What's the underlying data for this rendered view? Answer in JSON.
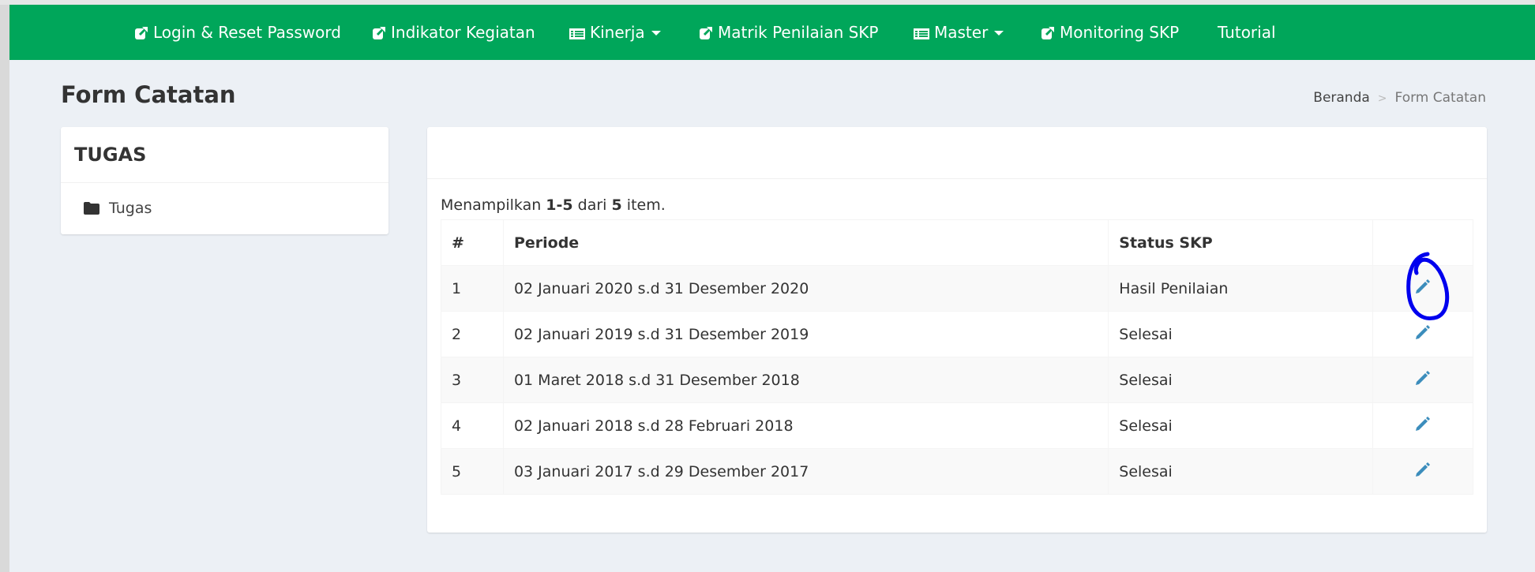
{
  "navbar": {
    "bg": "#00a65a",
    "items": [
      {
        "label": "Login & Reset Password",
        "icon": "external-link-icon"
      },
      {
        "label": "Indikator Kegiatan",
        "icon": "external-link-icon"
      },
      {
        "label": "Kinerja",
        "icon": "list-icon",
        "dropdown": true
      },
      {
        "label": "Matrik Penilaian SKP",
        "icon": "external-link-icon"
      },
      {
        "label": "Master",
        "icon": "list-icon",
        "dropdown": true
      },
      {
        "label": "Monitoring SKP",
        "icon": "external-link-icon"
      },
      {
        "label": "Tutorial"
      }
    ]
  },
  "page": {
    "title": "Form Catatan",
    "breadcrumb": {
      "home": "Beranda",
      "separator": ">",
      "current": "Form Catatan"
    }
  },
  "sidebar": {
    "title": "TUGAS",
    "items": [
      {
        "label": "Tugas",
        "icon": "folder-icon"
      }
    ]
  },
  "table": {
    "summary": {
      "prefix": "Menampilkan",
      "range": "1-5",
      "mid": "dari",
      "total": "5",
      "suffix": "item."
    },
    "headers": {
      "num": "#",
      "periode": "Periode",
      "status": "Status SKP"
    },
    "rows": [
      {
        "num": "1",
        "periode": "02 Januari 2020 s.d 31 Desember 2020",
        "status": "Hasil Penilaian"
      },
      {
        "num": "2",
        "periode": "02 Januari 2019 s.d 31 Desember 2019",
        "status": "Selesai"
      },
      {
        "num": "3",
        "periode": "01 Maret 2018 s.d 31 Desember 2018",
        "status": "Selesai"
      },
      {
        "num": "4",
        "periode": "02 Januari 2018 s.d 28 Februari 2018",
        "status": "Selesai"
      },
      {
        "num": "5",
        "periode": "03 Januari 2017 s.d 29 Desember 2017",
        "status": "Selesai"
      }
    ],
    "action_icon": "pencil-icon"
  },
  "colors": {
    "link": "#3c8dbc",
    "annotation": "#0000ee"
  }
}
